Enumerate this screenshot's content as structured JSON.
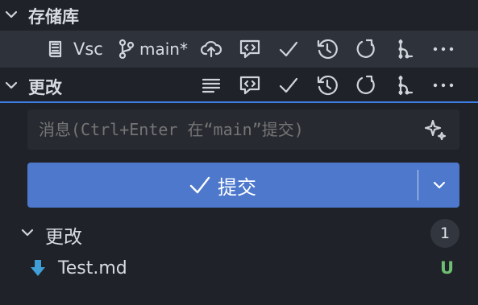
{
  "repositories": {
    "title": "存储库",
    "repo": {
      "name": "Vsc",
      "branch": "main*"
    }
  },
  "changes_view": {
    "title": "更改"
  },
  "commit": {
    "message_placeholder": "消息(Ctrl+Enter 在“main”提交)",
    "commit_label": "提交"
  },
  "changes_group": {
    "title": "更改",
    "count": "1",
    "files": [
      {
        "name": "Test.md",
        "status": "U",
        "status_color": "#6fbf73"
      }
    ]
  },
  "colors": {
    "background": "#1f2228",
    "accent": "#4d78cc",
    "focus_border": "#3d7ee6"
  }
}
